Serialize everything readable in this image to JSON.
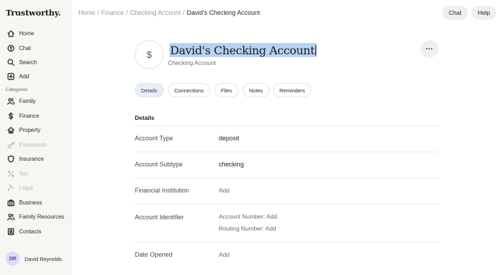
{
  "app": {
    "logo": "Trustworthy."
  },
  "sidebar": {
    "nav": [
      {
        "label": "Home",
        "icon": "home-icon"
      },
      {
        "label": "Chat",
        "icon": "chat-icon"
      },
      {
        "label": "Search",
        "icon": "search-icon"
      },
      {
        "label": "Add",
        "icon": "add-icon"
      }
    ],
    "categories_label": "Categories",
    "categories": [
      {
        "label": "Family",
        "icon": "people-icon",
        "enabled": true
      },
      {
        "label": "Finance",
        "icon": "dollar-icon",
        "enabled": true
      },
      {
        "label": "Property",
        "icon": "home-icon",
        "enabled": true
      },
      {
        "label": "Passwords",
        "icon": "key-icon",
        "enabled": false
      },
      {
        "label": "Insurance",
        "icon": "shield-icon",
        "enabled": true
      },
      {
        "label": "Tax",
        "icon": "percent-icon",
        "enabled": false
      },
      {
        "label": "Legal",
        "icon": "gavel-icon",
        "enabled": false
      },
      {
        "label": "Business",
        "icon": "briefcase-icon",
        "enabled": true
      },
      {
        "label": "Family Resources",
        "icon": "people-icon",
        "enabled": true
      },
      {
        "label": "Contacts",
        "icon": "contacts-icon",
        "enabled": true
      }
    ],
    "user": {
      "initials": "DR",
      "name": "David Reynolds"
    }
  },
  "breadcrumb": {
    "items": [
      "Home",
      "Finance",
      "Checking Account"
    ],
    "separator": "/",
    "current": "David's Checking Account"
  },
  "topbar": {
    "chat_label": "Chat",
    "help_label": "Help"
  },
  "header": {
    "icon_glyph": "$",
    "title": "David's Checking Account",
    "subtitle": "Checking Account",
    "more_glyph": "..."
  },
  "tabs": [
    {
      "label": "Details",
      "active": true
    },
    {
      "label": "Connections",
      "active": false
    },
    {
      "label": "Files",
      "active": false
    },
    {
      "label": "Notes",
      "active": false
    },
    {
      "label": "Reminders",
      "active": false
    }
  ],
  "details": {
    "section_title": "Details",
    "account_type": {
      "label": "Account Type",
      "value": "deposit"
    },
    "account_subtype": {
      "label": "Account Subtype",
      "value": "checking"
    },
    "financial_institution": {
      "label": "Financial Institution",
      "value": "Add"
    },
    "account_identifier": {
      "label": "Account Identifier",
      "account_number": "Account Number: Add",
      "routing_number": "Routing Number: Add"
    },
    "date_opened": {
      "label": "Date Opened",
      "value": "Add"
    }
  },
  "colors": {
    "selection": "#b7d2f2",
    "active_tab": "#e9eef4",
    "sidebar_bg": "#f7f6f3"
  }
}
